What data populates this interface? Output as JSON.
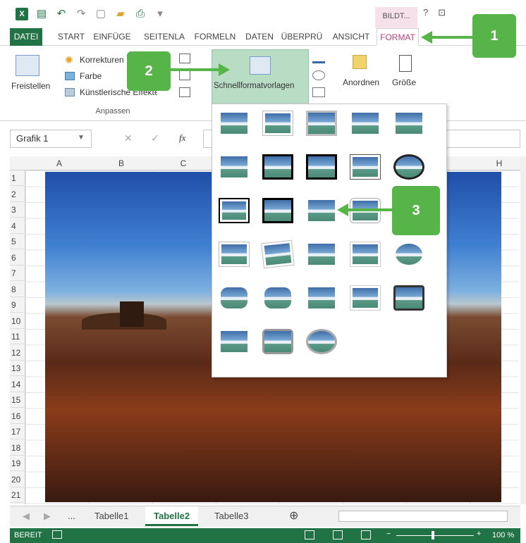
{
  "qat": {
    "save_icon": "save-icon",
    "undo_icon": "undo-icon",
    "redo_icon": "redo-icon"
  },
  "title": {
    "context_tab": "BILDT...",
    "help": "?"
  },
  "tabs": [
    "DATEI",
    "START",
    "EINFÜGE",
    "SEITENLA",
    "FORMELN",
    "DATEN",
    "ÜBERPRÜ",
    "ANSICHT",
    "FORMAT"
  ],
  "ribbon": {
    "freistellen": "Freistellen",
    "korrekturen": "Korrekturen",
    "farbe": "Farbe",
    "kunst": "Künstlerische Effekte",
    "group_anpassen": "Anpassen",
    "schnell": "Schnellformatvorlagen",
    "anordnen": "Anordnen",
    "groesse": "Größe"
  },
  "formula": {
    "namebox": "Grafik 1",
    "fx": "fx"
  },
  "columns": [
    "A",
    "B",
    "C",
    "H"
  ],
  "rows": [
    "1",
    "2",
    "3",
    "4",
    "5",
    "6",
    "7",
    "8",
    "9",
    "10",
    "11",
    "12",
    "13",
    "14",
    "15",
    "16",
    "17",
    "18",
    "19",
    "20",
    "21"
  ],
  "callouts": {
    "c1": "1",
    "c2": "2",
    "c3": "3"
  },
  "sheets": {
    "more": "...",
    "t1": "Tabelle1",
    "t2": "Tabelle2",
    "t3": "Tabelle3",
    "add": "⊕"
  },
  "status": {
    "ready": "BEREIT",
    "zoom": "100 %"
  },
  "colors": {
    "excel_green": "#217346",
    "callout_green": "#56b448",
    "format_pink": "#b4417a"
  }
}
